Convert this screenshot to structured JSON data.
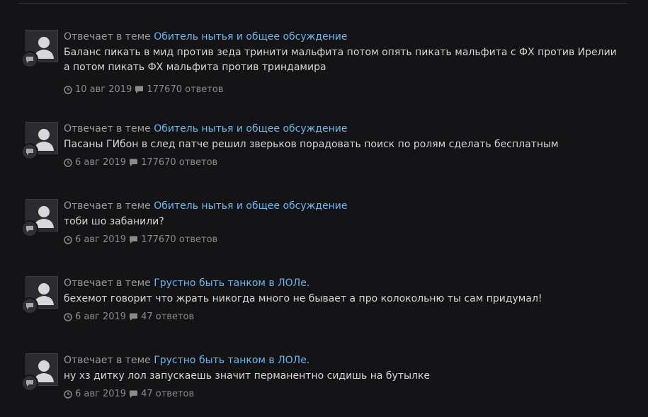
{
  "posts": [
    {
      "prefix": "Отвечает в теме",
      "topic": "Обитель нытья и общее обсуждение",
      "text": "Баланс пикать в мид против зеда тринити мальфита потом опять пикать мальфита с ФХ против Ирелии а потом пикать ФХ мальфита против триндамира",
      "date": "10 авг 2019",
      "replies": "177670 ответов"
    },
    {
      "prefix": "Отвечает в теме",
      "topic": "Обитель нытья и общее обсуждение",
      "text": "Пасаны ГИбон в след патче решил зверьков порадовать поиск по ролям сделать бесплатным",
      "date": "6 авг 2019",
      "replies": "177670 ответов"
    },
    {
      "prefix": "Отвечает в теме",
      "topic": "Обитель нытья и общее обсуждение",
      "text": "тоби шо забанили?",
      "date": "6 авг 2019",
      "replies": "177670 ответов"
    },
    {
      "prefix": "Отвечает в теме",
      "topic": "Грустно быть танком в ЛОЛе.",
      "text": "бехемот говорит что жрать никогда много не бывает а про колокольню ты сам придумал!",
      "date": "6 авг 2019",
      "replies": "47 ответов"
    },
    {
      "prefix": "Отвечает в теме",
      "topic": "Грустно быть танком в ЛОЛе.",
      "text": "ну хз дитку лол запускаешь  значит перманентно сидишь на бутылке",
      "date": "6 авг 2019",
      "replies": "47 ответов"
    }
  ],
  "icons": {
    "avatar": "default-user-avatar",
    "badge": "comment-icon",
    "date": "clock-icon",
    "replies": "comment-icon"
  },
  "colors": {
    "background": "#141416",
    "link": "#6cb7ef",
    "text": "#d6d6d6",
    "muted": "#9a9a9a"
  }
}
